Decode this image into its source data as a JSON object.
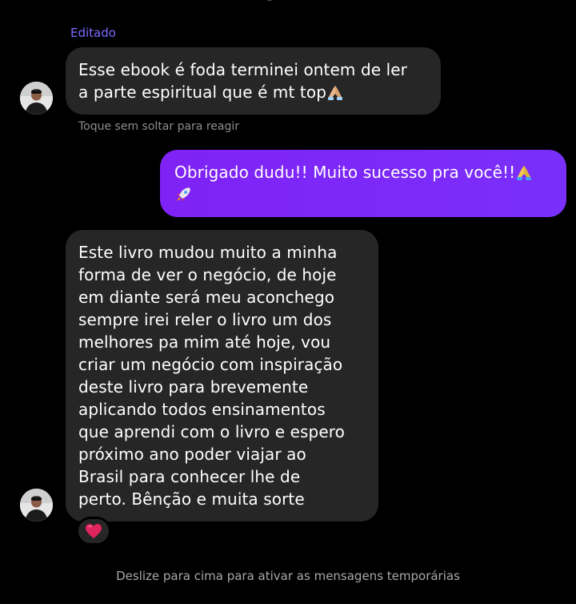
{
  "conversation": {
    "edited_label": "Editado",
    "reaction_hint": "Toque sem soltar para reagir",
    "footer_hint": "Deslize para cima para ativar as mensagens temporárias",
    "messages": [
      {
        "direction": "incoming",
        "lines": [
          "Esse ebook é foda terminei ontem de ler",
          "a parte espiritual que é mt top"
        ],
        "trailing_emoji": "folded-hands-icon"
      },
      {
        "direction": "outgoing",
        "lines": [
          "Obrigado dudu!! Muito sucesso pra você!!",
          ""
        ],
        "trailing_emoji": [
          "folded-hands-icon",
          "rocket-icon"
        ]
      },
      {
        "direction": "incoming",
        "lines": [
          "Este livro mudou muito a minha",
          "forma de ver o negócio, de hoje",
          "em diante será meu aconchego",
          "sempre irei reler o livro um dos",
          "melhores pa mim até hoje, vou",
          "criar um negócio com inspiração",
          "deste livro para brevemente",
          "aplicando todos ensinamentos",
          "que aprendi com o livro e espero",
          "próximo ano poder viajar ao",
          "Brasil para conhecer lhe de",
          "perto. Bênção e muita sorte"
        ],
        "reaction": "red-heart-icon"
      }
    ]
  },
  "colors": {
    "background": "#000000",
    "incoming_bubble": "#262626",
    "outgoing_bubble": "#7d20f7",
    "edited_accent": "#7b6cff",
    "hint_text": "#8e8e8e"
  }
}
